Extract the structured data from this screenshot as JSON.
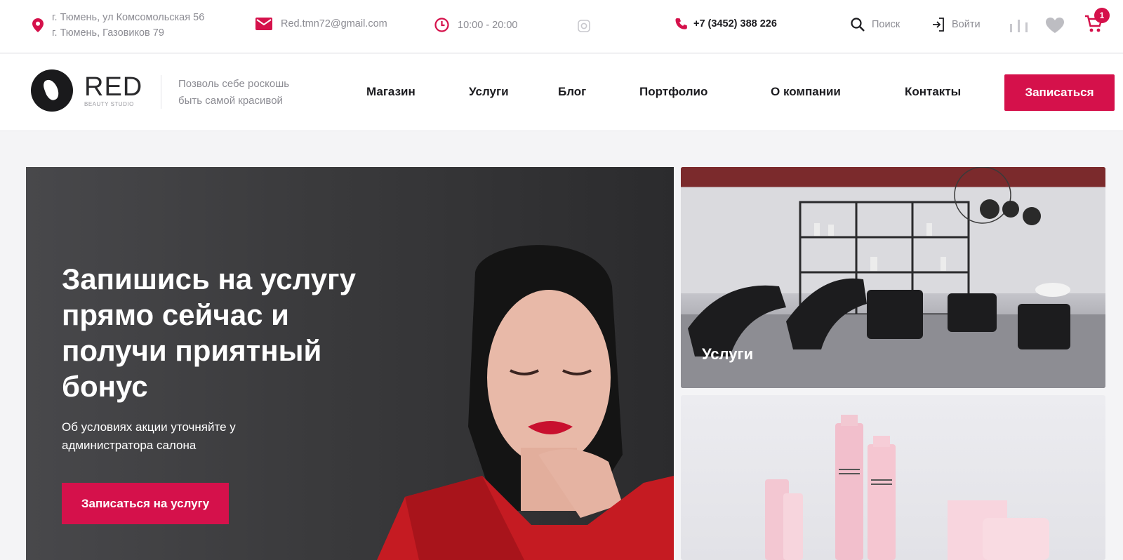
{
  "topbar": {
    "address_line1": "г. Тюмень, ул Комсомольская 56",
    "address_line2": "г. Тюмень, Газовиков 79",
    "email": "Red.tmn72@gmail.com",
    "hours": "10:00 - 20:00",
    "phone": "+7 (3452) 388 226",
    "search_label": "Поиск",
    "login_label": "Войти",
    "cart_count": "1"
  },
  "header": {
    "logo_title": "RED",
    "logo_subtitle": "BEAUTY STUDIO",
    "slogan": "Позволь себе роскошь быть самой красивой",
    "nav": [
      "Магазин",
      "Услуги",
      "Блог",
      "Портфолио",
      "О компании",
      "Контакты"
    ],
    "cta_label": "Записаться"
  },
  "hero": {
    "title": "Запишись на услугу прямо сейчас и получи приятный бонус",
    "subtitle": "Об условиях акции уточняйте у администратора салона",
    "button_label": "Записаться на услугу"
  },
  "tiles": {
    "services_label": "Услуги"
  },
  "colors": {
    "accent": "#d5114b",
    "text_dark": "#1b1b1f",
    "text_muted": "#8c8c93",
    "hero_bg": "#3a3a3c",
    "page_bg": "#f4f4f6"
  },
  "icons": [
    "location-pin-icon",
    "mail-icon",
    "clock-icon",
    "instagram-icon",
    "phone-icon",
    "search-icon",
    "login-icon",
    "compare-icon",
    "heart-icon",
    "cart-icon"
  ]
}
